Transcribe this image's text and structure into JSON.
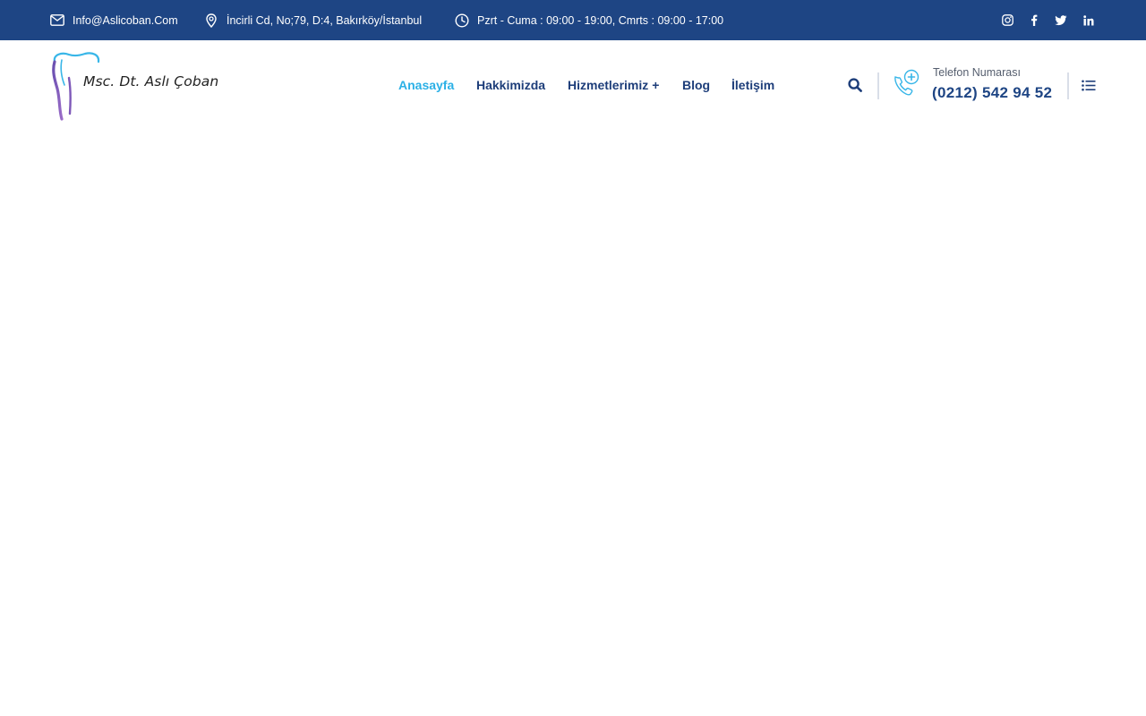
{
  "topbar": {
    "email": "Info@Aslicoban.Com",
    "address": "İncirli Cd, No;79, D:4, Bakırköy/İstanbul",
    "hours": "Pzrt - Cuma : 09:00 - 19:00, Cmrts : 09:00 - 17:00",
    "icons": {
      "email": "envelope-icon",
      "address": "map-pin-icon",
      "hours": "clock-icon"
    },
    "social": [
      "instagram-icon",
      "facebook-icon",
      "twitter-icon",
      "linkedin-icon"
    ]
  },
  "header": {
    "logo_text": "Msc. Dt. Aslı Çoban",
    "nav": [
      {
        "label": "Anasayfa",
        "active": true
      },
      {
        "label": "Hakkimizda"
      },
      {
        "label": "Hizmetlerimiz",
        "suffix": "+"
      },
      {
        "label": "Blog"
      },
      {
        "label": "İletişim"
      }
    ],
    "phone_label": "Telefon Numarası",
    "phone_number": "(0212) 542 94 52"
  },
  "colors": {
    "topbar_bg": "#1e4584",
    "nav_text": "#1e3e7a",
    "nav_active": "#2bb0e6",
    "phone_number": "#1e4584",
    "accent_light": "#38b6e8",
    "logo_purple": "#7d57b8"
  }
}
